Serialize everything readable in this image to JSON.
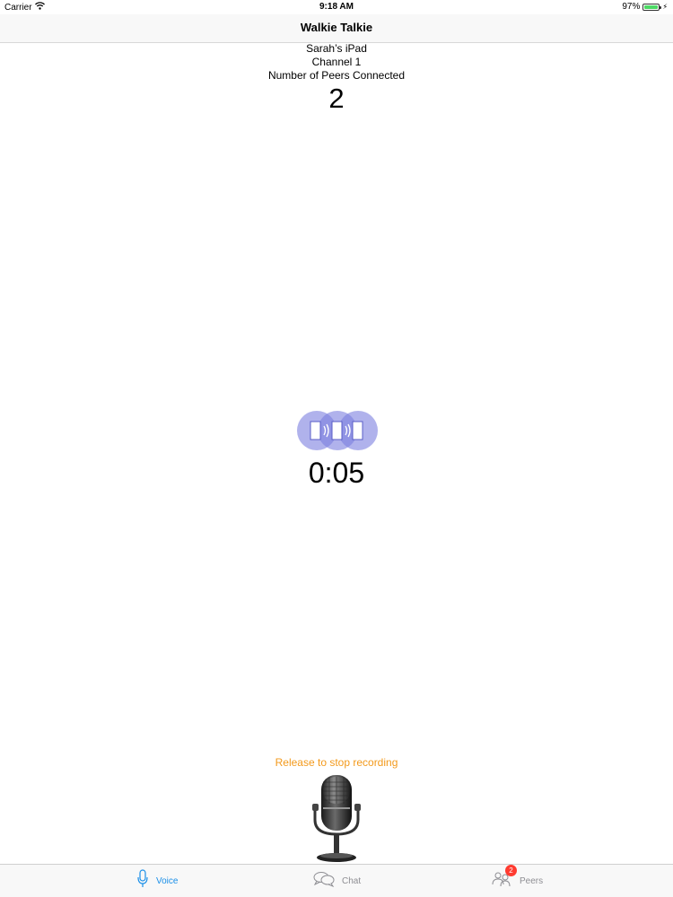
{
  "status_bar": {
    "carrier": "Carrier",
    "time": "9:18 AM",
    "battery_percent": "97%",
    "battery_level": 0.97
  },
  "nav": {
    "title": "Walkie Talkie"
  },
  "info": {
    "device_name": "Sarah’s iPad",
    "channel": "Channel 1",
    "peers_label": "Number of Peers Connected",
    "peers_count": "2"
  },
  "recording": {
    "timer": "0:05",
    "hint": "Release to stop recording",
    "icon": "microphone-icon"
  },
  "tabs": [
    {
      "label": "Voice",
      "icon": "microphone-icon",
      "active": true
    },
    {
      "label": "Chat",
      "icon": "chat-bubbles-icon",
      "active": false
    },
    {
      "label": "Peers",
      "icon": "peers-icon",
      "active": false,
      "badge": "2"
    }
  ],
  "colors": {
    "accent": "#1a8fe8",
    "hint": "#f39a1c",
    "badge": "#ff3b30",
    "indicator": "#7b7fe0"
  }
}
